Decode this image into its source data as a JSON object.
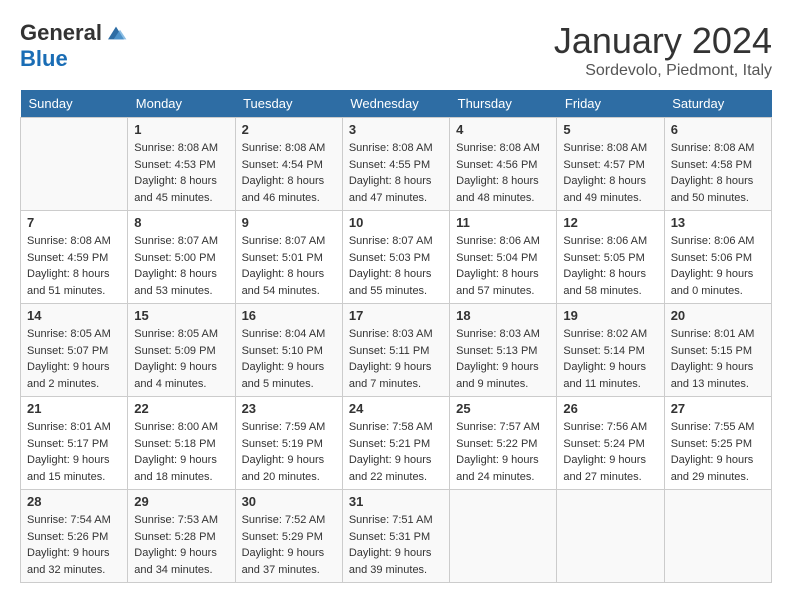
{
  "header": {
    "logo_general": "General",
    "logo_blue": "Blue",
    "month_title": "January 2024",
    "location": "Sordevolo, Piedmont, Italy"
  },
  "calendar": {
    "weekdays": [
      "Sunday",
      "Monday",
      "Tuesday",
      "Wednesday",
      "Thursday",
      "Friday",
      "Saturday"
    ],
    "weeks": [
      [
        {
          "day": "",
          "sunrise": "",
          "sunset": "",
          "daylight": ""
        },
        {
          "day": "1",
          "sunrise": "Sunrise: 8:08 AM",
          "sunset": "Sunset: 4:53 PM",
          "daylight": "Daylight: 8 hours and 45 minutes."
        },
        {
          "day": "2",
          "sunrise": "Sunrise: 8:08 AM",
          "sunset": "Sunset: 4:54 PM",
          "daylight": "Daylight: 8 hours and 46 minutes."
        },
        {
          "day": "3",
          "sunrise": "Sunrise: 8:08 AM",
          "sunset": "Sunset: 4:55 PM",
          "daylight": "Daylight: 8 hours and 47 minutes."
        },
        {
          "day": "4",
          "sunrise": "Sunrise: 8:08 AM",
          "sunset": "Sunset: 4:56 PM",
          "daylight": "Daylight: 8 hours and 48 minutes."
        },
        {
          "day": "5",
          "sunrise": "Sunrise: 8:08 AM",
          "sunset": "Sunset: 4:57 PM",
          "daylight": "Daylight: 8 hours and 49 minutes."
        },
        {
          "day": "6",
          "sunrise": "Sunrise: 8:08 AM",
          "sunset": "Sunset: 4:58 PM",
          "daylight": "Daylight: 8 hours and 50 minutes."
        }
      ],
      [
        {
          "day": "7",
          "sunrise": "Sunrise: 8:08 AM",
          "sunset": "Sunset: 4:59 PM",
          "daylight": "Daylight: 8 hours and 51 minutes."
        },
        {
          "day": "8",
          "sunrise": "Sunrise: 8:07 AM",
          "sunset": "Sunset: 5:00 PM",
          "daylight": "Daylight: 8 hours and 53 minutes."
        },
        {
          "day": "9",
          "sunrise": "Sunrise: 8:07 AM",
          "sunset": "Sunset: 5:01 PM",
          "daylight": "Daylight: 8 hours and 54 minutes."
        },
        {
          "day": "10",
          "sunrise": "Sunrise: 8:07 AM",
          "sunset": "Sunset: 5:03 PM",
          "daylight": "Daylight: 8 hours and 55 minutes."
        },
        {
          "day": "11",
          "sunrise": "Sunrise: 8:06 AM",
          "sunset": "Sunset: 5:04 PM",
          "daylight": "Daylight: 8 hours and 57 minutes."
        },
        {
          "day": "12",
          "sunrise": "Sunrise: 8:06 AM",
          "sunset": "Sunset: 5:05 PM",
          "daylight": "Daylight: 8 hours and 58 minutes."
        },
        {
          "day": "13",
          "sunrise": "Sunrise: 8:06 AM",
          "sunset": "Sunset: 5:06 PM",
          "daylight": "Daylight: 9 hours and 0 minutes."
        }
      ],
      [
        {
          "day": "14",
          "sunrise": "Sunrise: 8:05 AM",
          "sunset": "Sunset: 5:07 PM",
          "daylight": "Daylight: 9 hours and 2 minutes."
        },
        {
          "day": "15",
          "sunrise": "Sunrise: 8:05 AM",
          "sunset": "Sunset: 5:09 PM",
          "daylight": "Daylight: 9 hours and 4 minutes."
        },
        {
          "day": "16",
          "sunrise": "Sunrise: 8:04 AM",
          "sunset": "Sunset: 5:10 PM",
          "daylight": "Daylight: 9 hours and 5 minutes."
        },
        {
          "day": "17",
          "sunrise": "Sunrise: 8:03 AM",
          "sunset": "Sunset: 5:11 PM",
          "daylight": "Daylight: 9 hours and 7 minutes."
        },
        {
          "day": "18",
          "sunrise": "Sunrise: 8:03 AM",
          "sunset": "Sunset: 5:13 PM",
          "daylight": "Daylight: 9 hours and 9 minutes."
        },
        {
          "day": "19",
          "sunrise": "Sunrise: 8:02 AM",
          "sunset": "Sunset: 5:14 PM",
          "daylight": "Daylight: 9 hours and 11 minutes."
        },
        {
          "day": "20",
          "sunrise": "Sunrise: 8:01 AM",
          "sunset": "Sunset: 5:15 PM",
          "daylight": "Daylight: 9 hours and 13 minutes."
        }
      ],
      [
        {
          "day": "21",
          "sunrise": "Sunrise: 8:01 AM",
          "sunset": "Sunset: 5:17 PM",
          "daylight": "Daylight: 9 hours and 15 minutes."
        },
        {
          "day": "22",
          "sunrise": "Sunrise: 8:00 AM",
          "sunset": "Sunset: 5:18 PM",
          "daylight": "Daylight: 9 hours and 18 minutes."
        },
        {
          "day": "23",
          "sunrise": "Sunrise: 7:59 AM",
          "sunset": "Sunset: 5:19 PM",
          "daylight": "Daylight: 9 hours and 20 minutes."
        },
        {
          "day": "24",
          "sunrise": "Sunrise: 7:58 AM",
          "sunset": "Sunset: 5:21 PM",
          "daylight": "Daylight: 9 hours and 22 minutes."
        },
        {
          "day": "25",
          "sunrise": "Sunrise: 7:57 AM",
          "sunset": "Sunset: 5:22 PM",
          "daylight": "Daylight: 9 hours and 24 minutes."
        },
        {
          "day": "26",
          "sunrise": "Sunrise: 7:56 AM",
          "sunset": "Sunset: 5:24 PM",
          "daylight": "Daylight: 9 hours and 27 minutes."
        },
        {
          "day": "27",
          "sunrise": "Sunrise: 7:55 AM",
          "sunset": "Sunset: 5:25 PM",
          "daylight": "Daylight: 9 hours and 29 minutes."
        }
      ],
      [
        {
          "day": "28",
          "sunrise": "Sunrise: 7:54 AM",
          "sunset": "Sunset: 5:26 PM",
          "daylight": "Daylight: 9 hours and 32 minutes."
        },
        {
          "day": "29",
          "sunrise": "Sunrise: 7:53 AM",
          "sunset": "Sunset: 5:28 PM",
          "daylight": "Daylight: 9 hours and 34 minutes."
        },
        {
          "day": "30",
          "sunrise": "Sunrise: 7:52 AM",
          "sunset": "Sunset: 5:29 PM",
          "daylight": "Daylight: 9 hours and 37 minutes."
        },
        {
          "day": "31",
          "sunrise": "Sunrise: 7:51 AM",
          "sunset": "Sunset: 5:31 PM",
          "daylight": "Daylight: 9 hours and 39 minutes."
        },
        {
          "day": "",
          "sunrise": "",
          "sunset": "",
          "daylight": ""
        },
        {
          "day": "",
          "sunrise": "",
          "sunset": "",
          "daylight": ""
        },
        {
          "day": "",
          "sunrise": "",
          "sunset": "",
          "daylight": ""
        }
      ]
    ]
  }
}
